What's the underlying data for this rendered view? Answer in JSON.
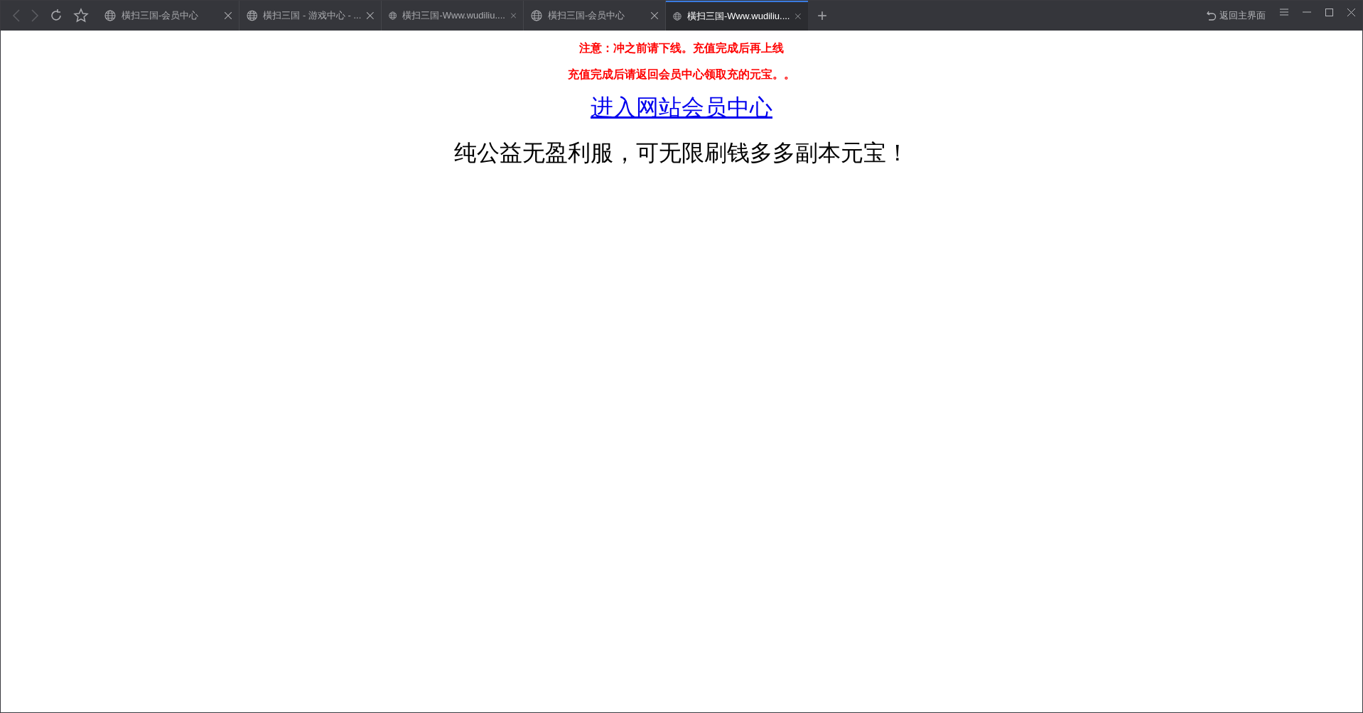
{
  "browser": {
    "tabs": [
      {
        "title": "橫扫三国-会员中心",
        "selected": false
      },
      {
        "title": "橫扫三国 - 游戏中心 - ...",
        "selected": false
      },
      {
        "title": "橫扫三国-Www.wudiliu....",
        "selected": false
      },
      {
        "title": "橫扫三国-会员中心",
        "selected": false
      },
      {
        "title": "橫扫三国-Www.wudiliu....",
        "selected": true
      }
    ],
    "new_tab": "+",
    "home_button": "返回主界面"
  },
  "page": {
    "notices": [
      "注意：冲之前请下线。充值完成后再上线",
      "充值完成后请返回会员中心领取充的元宝。。"
    ],
    "link": "进入网站会员中心",
    "headline": "纯公益无盈利服，可无限刷钱多多副本元宝！"
  }
}
